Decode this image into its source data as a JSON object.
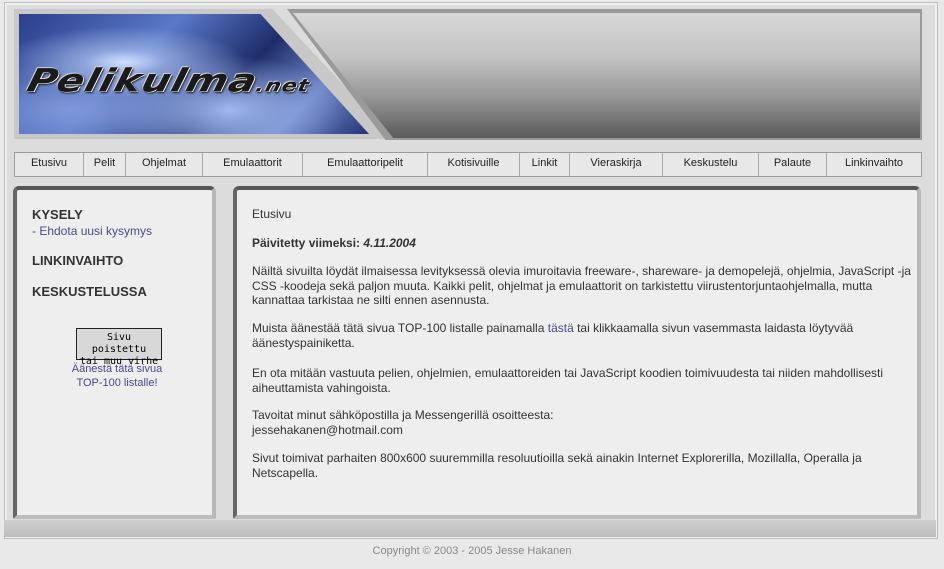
{
  "header": {
    "logo_main": "Pelikulma",
    "logo_suffix": ".net"
  },
  "nav": [
    {
      "label": "Etusivu"
    },
    {
      "label": "Pelit"
    },
    {
      "label": "Ohjelmat"
    },
    {
      "label": "Emulaattorit"
    },
    {
      "label": "Emulaattoripelit"
    },
    {
      "label": "Kotisivuille"
    },
    {
      "label": "Linkit"
    },
    {
      "label": "Vieraskirja"
    },
    {
      "label": "Keskustelu"
    },
    {
      "label": "Palaute"
    },
    {
      "label": "Linkinvaihto"
    }
  ],
  "sidebar": {
    "poll_heading": "KYSELY",
    "poll_link": "- Ehdota uusi kysymys",
    "link_exchange": "LINKINVAIHTO",
    "discussion": "KESKUSTELUSSA",
    "vote_box_line1": "Sivu poistettu",
    "vote_box_line2": "tai muu virhe",
    "vote_text_line1": "Äänestä tätä sivua",
    "vote_text_line2": "TOP-100 listalle!"
  },
  "main": {
    "title": "Etusivu",
    "updated_label": "Päivitetty viimeksi:",
    "updated_date": "4.11.2004",
    "para1": "Näiltä sivuilta löydät ilmaisessa levityksessä olevia imuroitavia freeware-, shareware- ja demopelejä, ohjelmia, JavaScript -ja CSS -koodeja sekä paljon muuta. Kaikki pelit, ohjelmat ja emulaattorit on tarkistettu viirustentorjuntaohjelmalla, mutta kannattaa tarkistaa ne silti ennen asennusta.",
    "para2_before": "Muista äänestää tätä sivua TOP-100 listalle painamalla ",
    "para2_link": "tästä",
    "para2_after": " tai klikkaamalla sivun vasemmasta laidasta löytyvää äänestyspainiketta.",
    "para3": "En ota mitään vastuuta pelien, ohjelmien, emulaattoreiden tai JavaScript koodien toimivuudesta tai niiden mahdollisesti aiheuttamista vahingoista.",
    "para4": "Tavoitat minut sähköpostilla ja Messengerillä osoitteesta:",
    "email": "jessehakanen@hotmail.com",
    "para5": "Sivut toimivat parhaiten 800x600 suuremmilla resoluutioilla sekä ainakin Internet Explorerilla, Mozillalla, Operalla ja Netscapella."
  },
  "footer": {
    "copyright": "Copyright © 2003 - 2005 Jesse Hakanen"
  }
}
